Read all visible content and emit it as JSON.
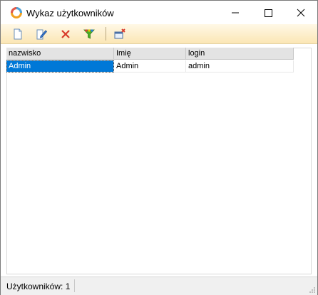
{
  "window": {
    "title": "Wykaz użytkowników"
  },
  "toolbar": {
    "buttons": [
      {
        "name": "new",
        "icon": "new-document-icon"
      },
      {
        "name": "edit",
        "icon": "edit-document-icon"
      },
      {
        "name": "delete",
        "icon": "delete-x-icon"
      },
      {
        "name": "filter",
        "icon": "filter-icon"
      },
      {
        "name": "close-window",
        "icon": "close-window-icon"
      }
    ]
  },
  "table": {
    "columns": [
      "nazwisko",
      "Imię",
      "login"
    ],
    "rows": [
      [
        "Admin",
        "Admin",
        "admin"
      ]
    ]
  },
  "status": {
    "count_label": "Użytkowników: 1"
  },
  "colors": {
    "selection": "#0078d7",
    "toolbar_top": "#fff8e6",
    "toolbar_bottom": "#fbe6b5"
  }
}
